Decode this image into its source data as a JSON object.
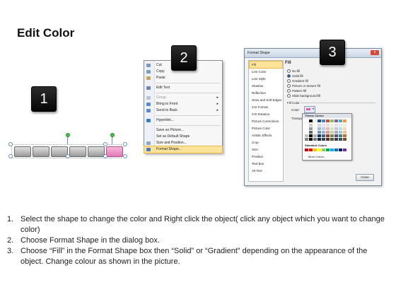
{
  "title": "Edit Color",
  "steps": [
    "1",
    "2",
    "3"
  ],
  "context_menu": {
    "items": [
      {
        "label": "Cut",
        "icon": "scissors-icon"
      },
      {
        "label": "Copy",
        "icon": "copy-icon"
      },
      {
        "label": "Paste",
        "icon": "paste-icon"
      },
      {
        "label": "Edit Text",
        "icon": "edit-text-icon"
      },
      {
        "label": "Group",
        "icon": "group-icon",
        "submenu": true
      },
      {
        "label": "Bring to Front",
        "icon": "bring-front-icon",
        "submenu": true
      },
      {
        "label": "Send to Back",
        "icon": "send-back-icon",
        "submenu": true
      },
      {
        "label": "Hyperlink...",
        "icon": "hyperlink-icon"
      },
      {
        "label": "Save as Picture...",
        "icon": "picture-icon"
      },
      {
        "label": "Set as Default Shape",
        "icon": "default-shape-icon"
      },
      {
        "label": "Size and Position...",
        "icon": "size-position-icon"
      },
      {
        "label": "Format Shape...",
        "icon": "format-shape-icon",
        "highlighted": true
      }
    ],
    "submenu_arrow": "▸"
  },
  "dialog": {
    "title": "Format Shape",
    "close_glyph": "x",
    "categories": [
      "Fill",
      "Line Color",
      "Line Style",
      "Shadow",
      "Reflection",
      "Glow and Soft Edges",
      "3-D Format",
      "3-D Rotation",
      "Picture Corrections",
      "Picture Color",
      "Artistic Effects",
      "Crop",
      "Size",
      "Position",
      "Text Box",
      "Alt Text"
    ],
    "selected_category": "Fill",
    "fill_heading": "Fill",
    "fill_options": [
      "No fill",
      "Solid fill",
      "Gradient fill",
      "Picture or texture fill",
      "Pattern fill",
      "Slide background fill"
    ],
    "selected_fill": "Solid fill",
    "fill_color_heading": "Fill Color",
    "color_label": "Color:",
    "transparency_label": "Transpa",
    "close_button": "Close"
  },
  "palette": {
    "theme_heading": "Theme Colors",
    "standard_heading": "Standard Colors",
    "more_colors": "More Colors...",
    "theme_colors": [
      "#ffffff",
      "#000000",
      "#eeece1",
      "#1f497d",
      "#4f81bd",
      "#c0504d",
      "#9bbb59",
      "#8064a2",
      "#4bacc6",
      "#f79646"
    ],
    "standard_colors": [
      "#c00000",
      "#ff0000",
      "#ffc000",
      "#ffff00",
      "#92d050",
      "#00b050",
      "#00b0f0",
      "#0070c0",
      "#002060",
      "#7030a0"
    ],
    "current_color": "#e85aa6"
  },
  "instructions": [
    {
      "num": "1.",
      "text": "Select the shape to change the color and Right click the object( click any object which you want to change color)"
    },
    {
      "num": "2.",
      "text": "Choose Format Shape in the dialog box."
    },
    {
      "num": "3.",
      "text": "Choose “Fill” in the Format Shape box then “Solid” or “Gradient” depending on the appearance of the object. Change colour as shown in the picture."
    }
  ]
}
